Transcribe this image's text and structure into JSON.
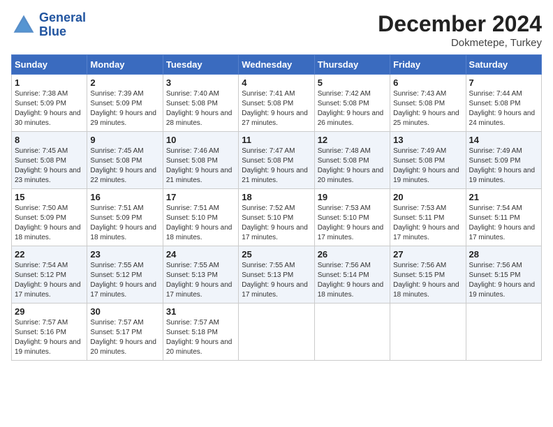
{
  "logo": {
    "line1": "General",
    "line2": "Blue"
  },
  "title": "December 2024",
  "subtitle": "Dokmetepe, Turkey",
  "headers": [
    "Sunday",
    "Monday",
    "Tuesday",
    "Wednesday",
    "Thursday",
    "Friday",
    "Saturday"
  ],
  "weeks": [
    [
      {
        "day": "1",
        "sunrise": "Sunrise: 7:38 AM",
        "sunset": "Sunset: 5:09 PM",
        "daylight": "Daylight: 9 hours and 30 minutes."
      },
      {
        "day": "2",
        "sunrise": "Sunrise: 7:39 AM",
        "sunset": "Sunset: 5:09 PM",
        "daylight": "Daylight: 9 hours and 29 minutes."
      },
      {
        "day": "3",
        "sunrise": "Sunrise: 7:40 AM",
        "sunset": "Sunset: 5:08 PM",
        "daylight": "Daylight: 9 hours and 28 minutes."
      },
      {
        "day": "4",
        "sunrise": "Sunrise: 7:41 AM",
        "sunset": "Sunset: 5:08 PM",
        "daylight": "Daylight: 9 hours and 27 minutes."
      },
      {
        "day": "5",
        "sunrise": "Sunrise: 7:42 AM",
        "sunset": "Sunset: 5:08 PM",
        "daylight": "Daylight: 9 hours and 26 minutes."
      },
      {
        "day": "6",
        "sunrise": "Sunrise: 7:43 AM",
        "sunset": "Sunset: 5:08 PM",
        "daylight": "Daylight: 9 hours and 25 minutes."
      },
      {
        "day": "7",
        "sunrise": "Sunrise: 7:44 AM",
        "sunset": "Sunset: 5:08 PM",
        "daylight": "Daylight: 9 hours and 24 minutes."
      }
    ],
    [
      {
        "day": "8",
        "sunrise": "Sunrise: 7:45 AM",
        "sunset": "Sunset: 5:08 PM",
        "daylight": "Daylight: 9 hours and 23 minutes."
      },
      {
        "day": "9",
        "sunrise": "Sunrise: 7:45 AM",
        "sunset": "Sunset: 5:08 PM",
        "daylight": "Daylight: 9 hours and 22 minutes."
      },
      {
        "day": "10",
        "sunrise": "Sunrise: 7:46 AM",
        "sunset": "Sunset: 5:08 PM",
        "daylight": "Daylight: 9 hours and 21 minutes."
      },
      {
        "day": "11",
        "sunrise": "Sunrise: 7:47 AM",
        "sunset": "Sunset: 5:08 PM",
        "daylight": "Daylight: 9 hours and 21 minutes."
      },
      {
        "day": "12",
        "sunrise": "Sunrise: 7:48 AM",
        "sunset": "Sunset: 5:08 PM",
        "daylight": "Daylight: 9 hours and 20 minutes."
      },
      {
        "day": "13",
        "sunrise": "Sunrise: 7:49 AM",
        "sunset": "Sunset: 5:08 PM",
        "daylight": "Daylight: 9 hours and 19 minutes."
      },
      {
        "day": "14",
        "sunrise": "Sunrise: 7:49 AM",
        "sunset": "Sunset: 5:09 PM",
        "daylight": "Daylight: 9 hours and 19 minutes."
      }
    ],
    [
      {
        "day": "15",
        "sunrise": "Sunrise: 7:50 AM",
        "sunset": "Sunset: 5:09 PM",
        "daylight": "Daylight: 9 hours and 18 minutes."
      },
      {
        "day": "16",
        "sunrise": "Sunrise: 7:51 AM",
        "sunset": "Sunset: 5:09 PM",
        "daylight": "Daylight: 9 hours and 18 minutes."
      },
      {
        "day": "17",
        "sunrise": "Sunrise: 7:51 AM",
        "sunset": "Sunset: 5:10 PM",
        "daylight": "Daylight: 9 hours and 18 minutes."
      },
      {
        "day": "18",
        "sunrise": "Sunrise: 7:52 AM",
        "sunset": "Sunset: 5:10 PM",
        "daylight": "Daylight: 9 hours and 17 minutes."
      },
      {
        "day": "19",
        "sunrise": "Sunrise: 7:53 AM",
        "sunset": "Sunset: 5:10 PM",
        "daylight": "Daylight: 9 hours and 17 minutes."
      },
      {
        "day": "20",
        "sunrise": "Sunrise: 7:53 AM",
        "sunset": "Sunset: 5:11 PM",
        "daylight": "Daylight: 9 hours and 17 minutes."
      },
      {
        "day": "21",
        "sunrise": "Sunrise: 7:54 AM",
        "sunset": "Sunset: 5:11 PM",
        "daylight": "Daylight: 9 hours and 17 minutes."
      }
    ],
    [
      {
        "day": "22",
        "sunrise": "Sunrise: 7:54 AM",
        "sunset": "Sunset: 5:12 PM",
        "daylight": "Daylight: 9 hours and 17 minutes."
      },
      {
        "day": "23",
        "sunrise": "Sunrise: 7:55 AM",
        "sunset": "Sunset: 5:12 PM",
        "daylight": "Daylight: 9 hours and 17 minutes."
      },
      {
        "day": "24",
        "sunrise": "Sunrise: 7:55 AM",
        "sunset": "Sunset: 5:13 PM",
        "daylight": "Daylight: 9 hours and 17 minutes."
      },
      {
        "day": "25",
        "sunrise": "Sunrise: 7:55 AM",
        "sunset": "Sunset: 5:13 PM",
        "daylight": "Daylight: 9 hours and 17 minutes."
      },
      {
        "day": "26",
        "sunrise": "Sunrise: 7:56 AM",
        "sunset": "Sunset: 5:14 PM",
        "daylight": "Daylight: 9 hours and 18 minutes."
      },
      {
        "day": "27",
        "sunrise": "Sunrise: 7:56 AM",
        "sunset": "Sunset: 5:15 PM",
        "daylight": "Daylight: 9 hours and 18 minutes."
      },
      {
        "day": "28",
        "sunrise": "Sunrise: 7:56 AM",
        "sunset": "Sunset: 5:15 PM",
        "daylight": "Daylight: 9 hours and 19 minutes."
      }
    ],
    [
      {
        "day": "29",
        "sunrise": "Sunrise: 7:57 AM",
        "sunset": "Sunset: 5:16 PM",
        "daylight": "Daylight: 9 hours and 19 minutes."
      },
      {
        "day": "30",
        "sunrise": "Sunrise: 7:57 AM",
        "sunset": "Sunset: 5:17 PM",
        "daylight": "Daylight: 9 hours and 20 minutes."
      },
      {
        "day": "31",
        "sunrise": "Sunrise: 7:57 AM",
        "sunset": "Sunset: 5:18 PM",
        "daylight": "Daylight: 9 hours and 20 minutes."
      },
      null,
      null,
      null,
      null
    ]
  ]
}
